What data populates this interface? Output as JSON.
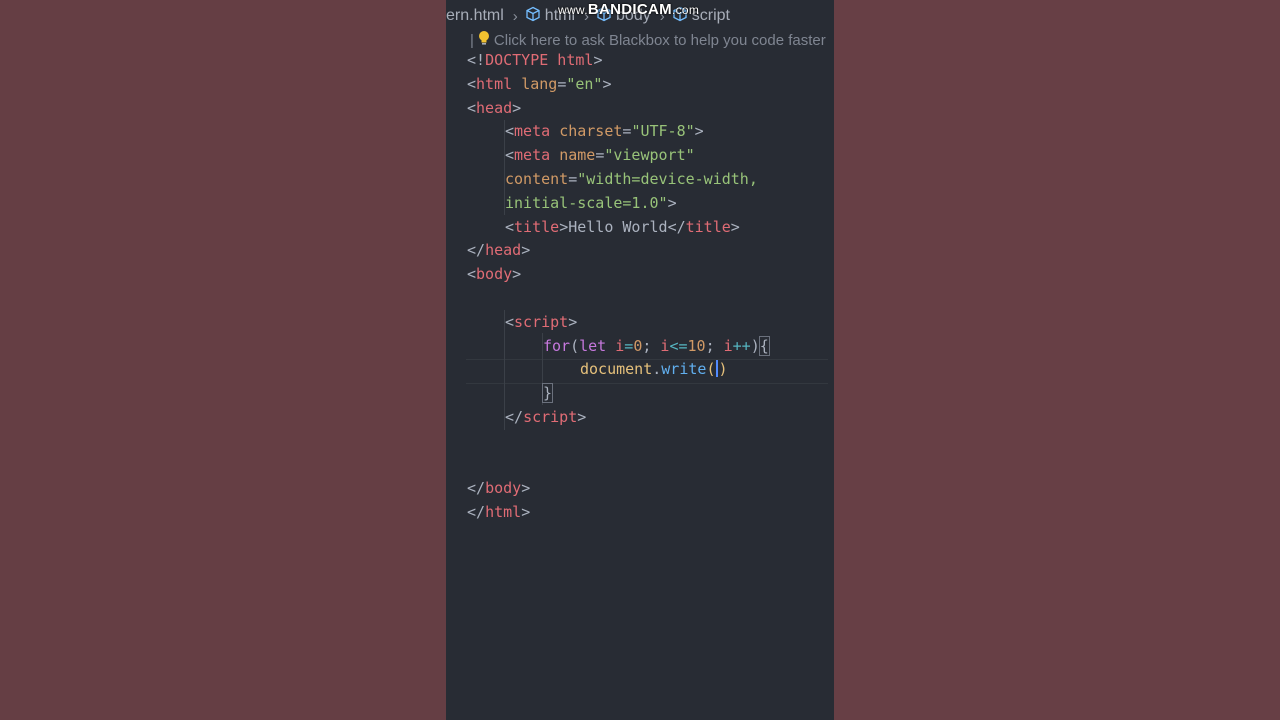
{
  "watermark": {
    "prefix": "www.",
    "brand": "BANDICAM",
    "suffix": ".com"
  },
  "breadcrumb": {
    "file": "ern.html",
    "items": [
      "html",
      "body",
      "script"
    ]
  },
  "blackbox_hint": "Click here to ask Blackbox to help you code faster",
  "code": {
    "l1_open": "<!",
    "l1_doctype": "DOCTYPE",
    "l1_html": " html",
    "l1_close": ">",
    "html_tag": "html",
    "lang_attr": "lang",
    "lang_val": "\"en\"",
    "head_tag": "head",
    "meta_tag": "meta",
    "charset_attr": "charset",
    "charset_val": "\"UTF-8\"",
    "name_attr": "name",
    "name_val": "\"viewport\"",
    "content_attr": "content",
    "content_val_1": "\"width=device-width,",
    "content_val_2": "initial-scale=1.0\"",
    "title_tag": "title",
    "title_text": "Hello World",
    "body_tag": "body",
    "script_tag": "script",
    "for_kw": "for",
    "let_kw": "let",
    "var_i": "i",
    "zero": "0",
    "ten": "10",
    "le_op": "<=",
    "inc_op": "++",
    "document_obj": "document",
    "write_fn": "write"
  },
  "colors": {
    "editor_bg": "#282c34",
    "side_bg": "#663f45",
    "tag": "#e06c75",
    "attribute": "#d19a66",
    "string": "#98c379",
    "keyword": "#c678dd",
    "function": "#61afef"
  },
  "icons": [
    "cube-icon",
    "lightbulb-icon"
  ]
}
